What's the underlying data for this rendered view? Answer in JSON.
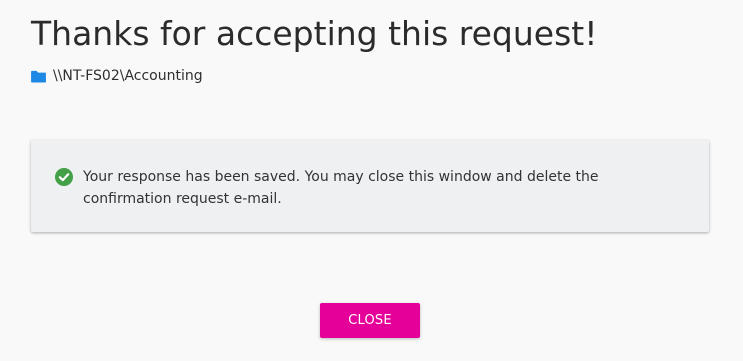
{
  "header": {
    "title": "Thanks for accepting this request!",
    "path": "\\\\NT-FS02\\Accounting"
  },
  "card": {
    "message": "Your response has been saved. You may close this window and delete the confirmation request e-mail."
  },
  "actions": {
    "close_label": "CLOSE"
  },
  "icons": {
    "folder": "folder-icon",
    "success": "check-circle-icon"
  },
  "colors": {
    "accent": "#e6009a",
    "folder": "#1e88e5",
    "success": "#43a047",
    "card_background": "#eef0f1",
    "page_background": "#f9f9f9"
  }
}
